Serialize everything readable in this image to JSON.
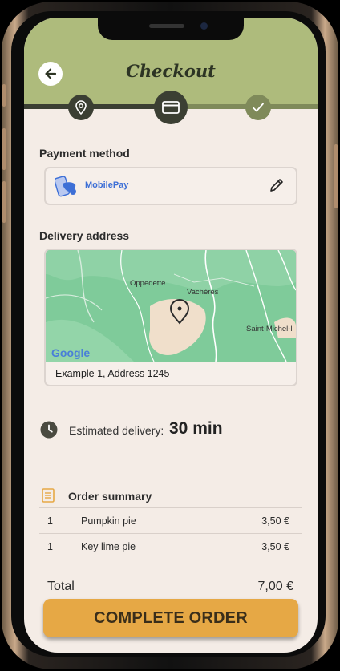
{
  "header": {
    "title": "Checkout"
  },
  "stepper": {
    "steps": [
      {
        "icon": "location-pin-icon",
        "state": "done"
      },
      {
        "icon": "credit-card-icon",
        "state": "active"
      },
      {
        "icon": "checkmark-icon",
        "state": "pending"
      }
    ]
  },
  "payment": {
    "label": "Payment method",
    "provider": "MobilePay",
    "provider_icon": "mobilepay-logo",
    "edit_icon": "pencil-icon"
  },
  "delivery": {
    "label": "Delivery address",
    "map_labels": [
      "Oppedette",
      "Vachères",
      "Saint-Michel-l'"
    ],
    "map_brand": "Google",
    "address": "Example 1, Address 1245"
  },
  "eta": {
    "label": "Estimated delivery:",
    "value": "30 min"
  },
  "summary": {
    "title": "Order summary",
    "items": [
      {
        "qty": "1",
        "name": "Pumpkin pie",
        "price": "3,50 €"
      },
      {
        "qty": "1",
        "name": "Key lime pie",
        "price": "3,50 €"
      }
    ],
    "total_label": "Total",
    "total_value": "7,00 €"
  },
  "cta": {
    "label": "COMPLETE ORDER"
  },
  "colors": {
    "header": "#aebb7c",
    "background": "#f4ece6",
    "step_dark": "#3b3f33",
    "step_pending": "#7f8a5a",
    "cta": "#e6a845"
  }
}
